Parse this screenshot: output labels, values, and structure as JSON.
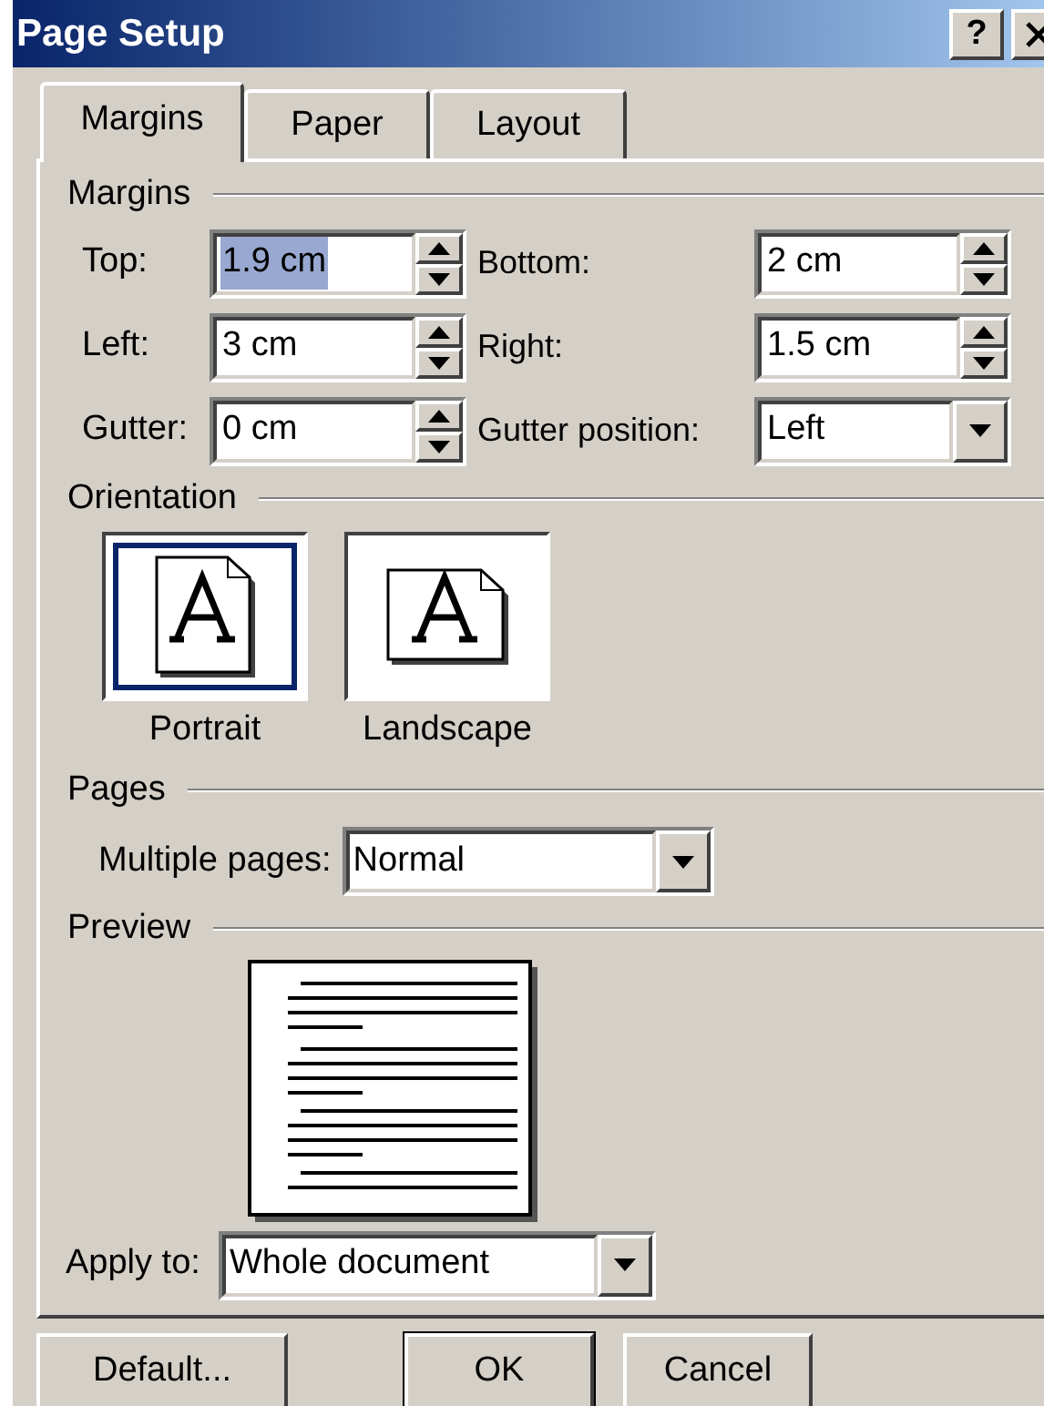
{
  "window": {
    "title": "Page Setup",
    "help_button": "?"
  },
  "tabs": [
    {
      "label": "Margins",
      "selected": true
    },
    {
      "label": "Paper",
      "selected": false
    },
    {
      "label": "Layout",
      "selected": false
    }
  ],
  "margins": {
    "heading": "Margins",
    "fields": [
      {
        "label": "Top:",
        "value": "1.9 cm",
        "kind": "spin",
        "focused": true
      },
      {
        "label": "Bottom:",
        "value": "2 cm",
        "kind": "spin",
        "focused": false
      },
      {
        "label": "Left:",
        "value": "3 cm",
        "kind": "spin",
        "focused": false
      },
      {
        "label": "Right:",
        "value": "1.5 cm",
        "kind": "spin",
        "focused": false
      },
      {
        "label": "Gutter:",
        "value": "0 cm",
        "kind": "spin",
        "focused": false
      },
      {
        "label": "Gutter position:",
        "value": "Left",
        "kind": "dropdown",
        "focused": false
      }
    ]
  },
  "orientation": {
    "heading": "Orientation",
    "options": [
      {
        "label": "Portrait",
        "kind": "portrait",
        "selected": true
      },
      {
        "label": "Landscape",
        "kind": "landscape",
        "selected": false
      }
    ]
  },
  "pages": {
    "heading": "Pages",
    "multiple_pages": {
      "label": "Multiple pages:",
      "value": "Normal"
    }
  },
  "preview": {
    "heading": "Preview",
    "apply_to": {
      "label": "Apply to:",
      "value": "Whole document"
    }
  },
  "buttons": [
    {
      "label": "Default...",
      "default": false
    },
    {
      "label": "OK",
      "default": true
    },
    {
      "label": "Cancel",
      "default": false
    }
  ]
}
